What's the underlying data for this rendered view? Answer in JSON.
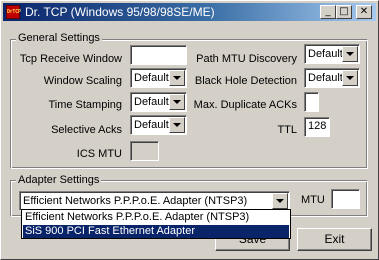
{
  "window": {
    "title": "Dr. TCP (Windows 95/98/98SE/ME)",
    "app_icon_text": "DrTCP",
    "minimize_glyph": "_",
    "maximize_glyph": "□",
    "close_glyph": "✕"
  },
  "general": {
    "legend": "General Settings",
    "tcp_receive_window": {
      "label": "Tcp Receive Window",
      "value": ""
    },
    "window_scaling": {
      "label": "Window Scaling",
      "value": "Default"
    },
    "time_stamping": {
      "label": "Time Stamping",
      "value": "Default"
    },
    "selective_acks": {
      "label": "Selective Acks",
      "value": "Default"
    },
    "ics_mtu": {
      "label": "ICS MTU",
      "value": ""
    },
    "path_mtu_discovery": {
      "label": "Path MTU Discovery",
      "value": "Default"
    },
    "black_hole_detection": {
      "label": "Black Hole Detection",
      "value": "Default"
    },
    "max_duplicate_acks": {
      "label": "Max. Duplicate ACKs",
      "value": ""
    },
    "ttl": {
      "label": "TTL",
      "value": "128"
    }
  },
  "adapter": {
    "legend": "Adapter Settings",
    "selected": "Efficient Networks P.P.P.o.E. Adapter (NTSP3)",
    "mtu_label": "MTU",
    "mtu_value": "",
    "options": [
      "Efficient Networks P.P.P.o.E. Adapter (NTSP3)",
      "SiS 900 PCI Fast Ethernet Adapter"
    ]
  },
  "buttons": {
    "save": "Save",
    "exit": "Exit"
  }
}
